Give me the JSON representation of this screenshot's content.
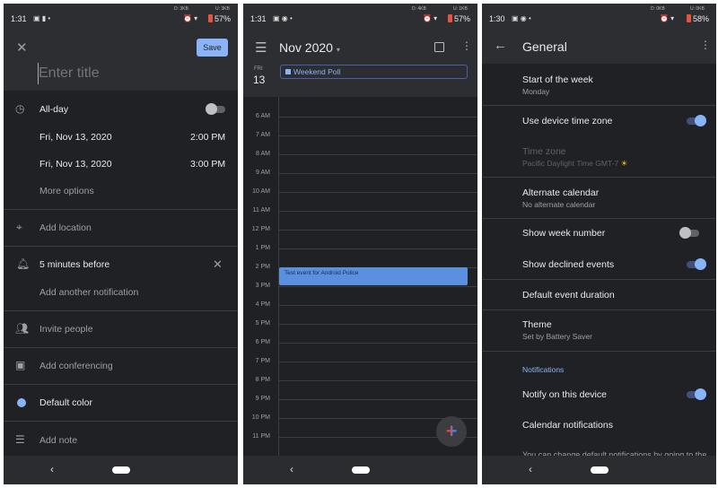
{
  "left": {
    "status": {
      "time": "1:31",
      "down": "D: 3KB",
      "up": "U: 3KB",
      "battery": "57%"
    },
    "close_icon": "close-icon",
    "save_label": "Save",
    "title_placeholder": "Enter title",
    "allday_label": "All-day",
    "allday_on": false,
    "start_date": "Fri, Nov 13, 2020",
    "start_time": "2:00 PM",
    "end_date": "Fri, Nov 13, 2020",
    "end_time": "3:00 PM",
    "more_options": "More options",
    "add_location": "Add location",
    "notification": "5 minutes before",
    "add_notification": "Add another notification",
    "invite": "Invite people",
    "conferencing": "Add conferencing",
    "color_label": "Default color",
    "color": "#8ab4f8",
    "note": "Add note"
  },
  "middle": {
    "status": {
      "time": "1:31",
      "down": "D: 4KB",
      "up": "U: 1KB",
      "battery": "57%"
    },
    "month": "Nov 2020",
    "day_name": "FRI",
    "day_num": "13",
    "allday_event": "Weekend Poll",
    "hours": [
      "6 AM",
      "7 AM",
      "8 AM",
      "9 AM",
      "10 AM",
      "11 AM",
      "12 PM",
      "1 PM",
      "2 PM",
      "3 PM",
      "4 PM",
      "5 PM",
      "6 PM",
      "7 PM",
      "8 PM",
      "9 PM",
      "10 PM",
      "11 PM"
    ],
    "event": {
      "title": "Test event for Android Police",
      "start": "2 PM",
      "end": "3 PM",
      "color": "#5b8fe0"
    }
  },
  "right": {
    "status": {
      "time": "1:30",
      "down": "D: 0KB",
      "up": "U: 0KB",
      "battery": "58%"
    },
    "title": "General",
    "start_week": {
      "label": "Start of the week",
      "value": "Monday"
    },
    "device_tz": {
      "label": "Use device time zone",
      "on": true
    },
    "time_zone": {
      "label": "Time zone",
      "value": "Pacific Daylight Time  GMT-7"
    },
    "alt_cal": {
      "label": "Alternate calendar",
      "value": "No alternate calendar"
    },
    "week_num": {
      "label": "Show week number",
      "on": false
    },
    "declined": {
      "label": "Show declined events",
      "on": true
    },
    "duration": {
      "label": "Default event duration"
    },
    "theme": {
      "label": "Theme",
      "value": "Set by Battery Saver"
    },
    "notif_header": "Notifications",
    "notify": {
      "label": "Notify on this device",
      "on": true
    },
    "cal_notif": "Calendar notifications",
    "footer_text": "You can change default notifications by going to the"
  },
  "accent": "#8ab4f8"
}
